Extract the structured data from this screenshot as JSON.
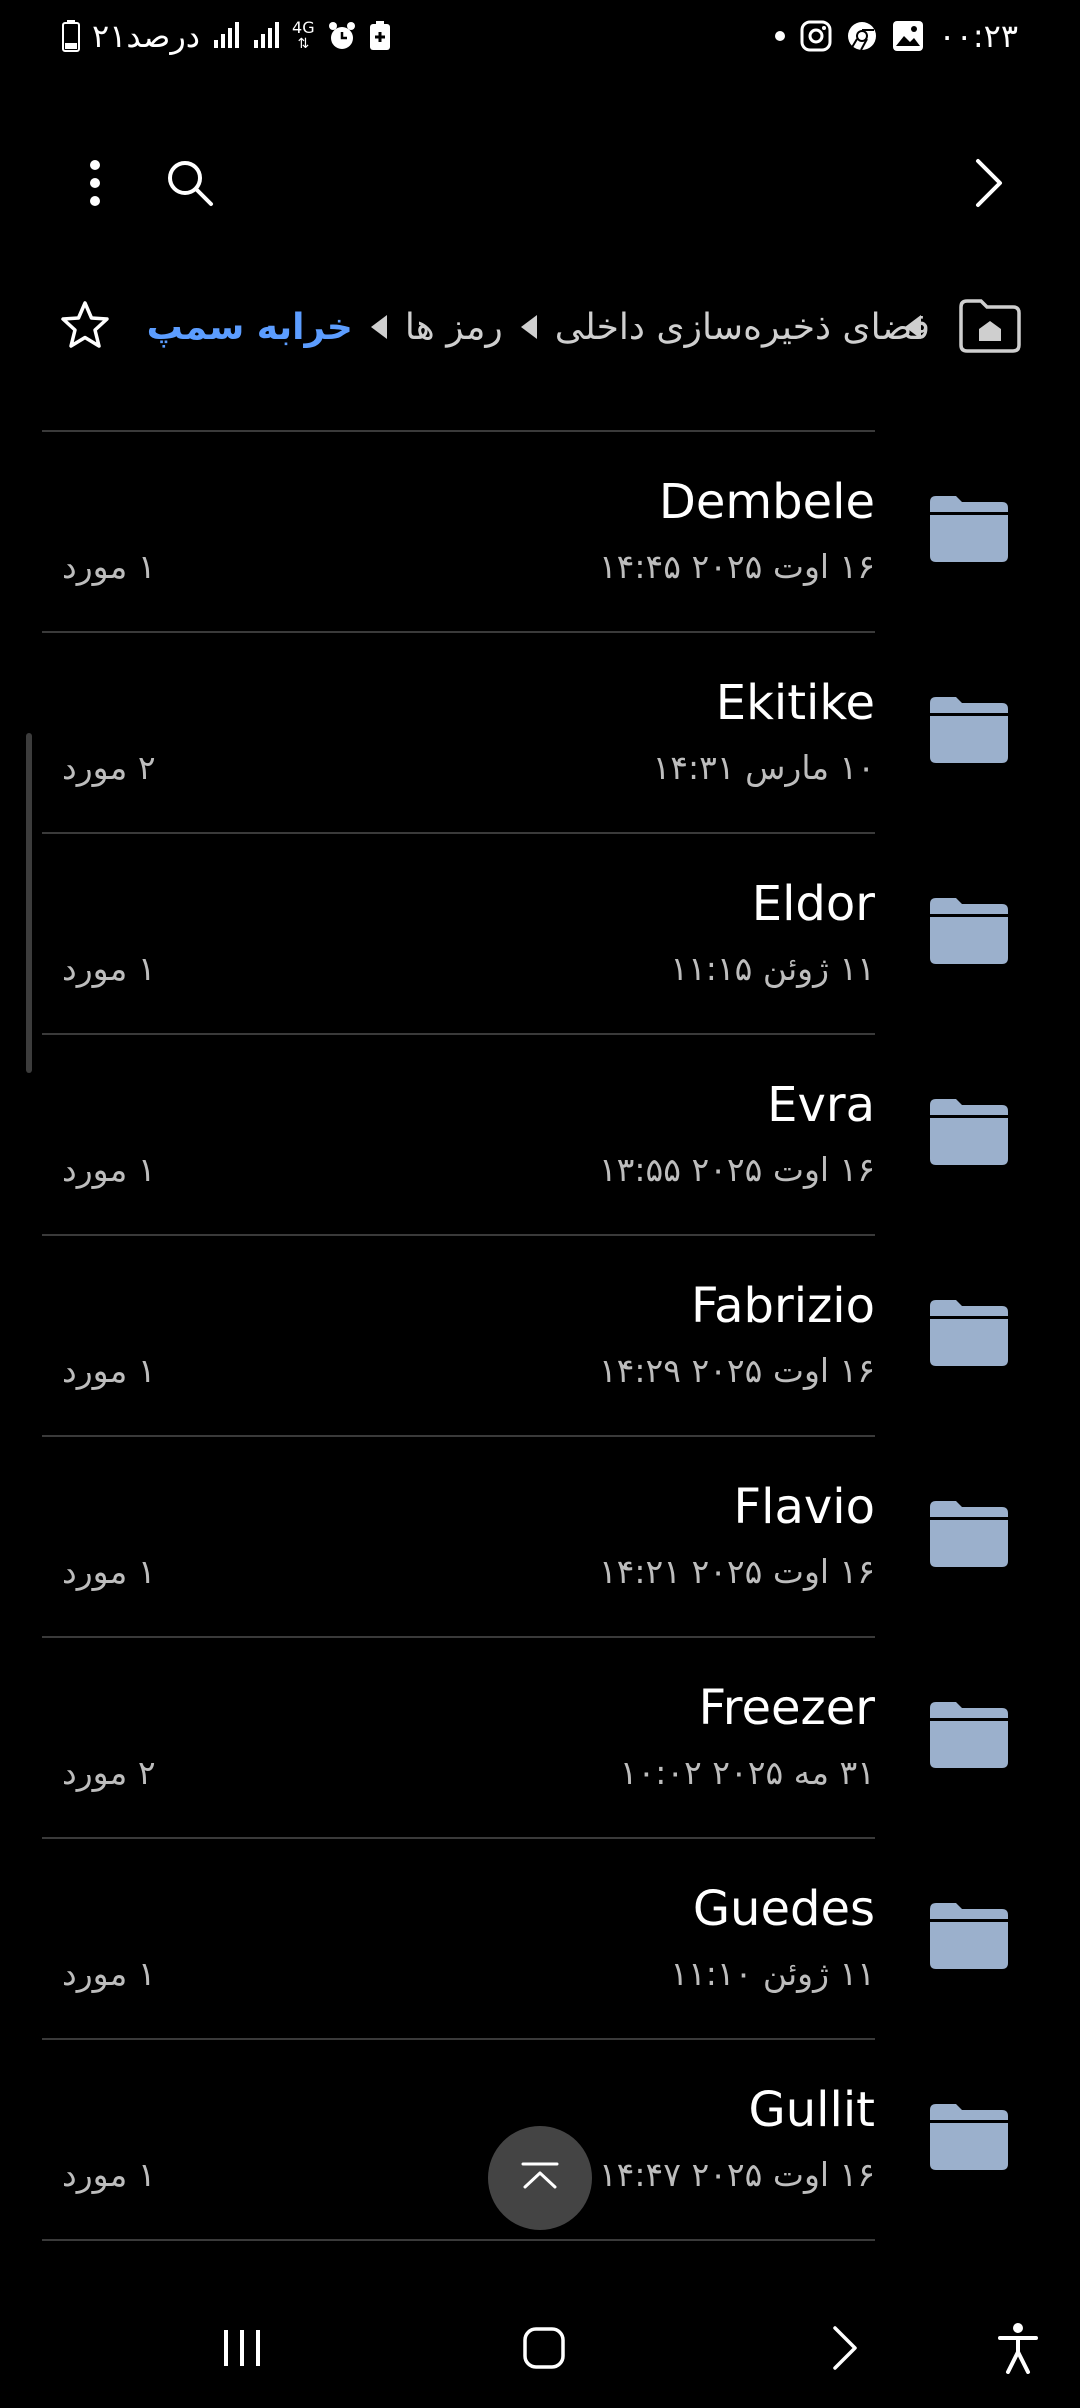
{
  "status_bar": {
    "time": "۰۰:۲۳",
    "battery_text": "۲۱درصد",
    "network": "4G",
    "colors": {
      "text": "#ffffff"
    },
    "icons": [
      "gallery-icon",
      "chrome-icon",
      "instagram-icon",
      "dot-icon",
      "alarm-icon",
      "battery-saver-icon",
      "signal-icon",
      "battery-icon"
    ]
  },
  "top_bar": {
    "icons": [
      "more-options-icon",
      "search-icon",
      "forward-arrow-icon"
    ]
  },
  "breadcrumb": {
    "items": [
      "فضای ذخیره‌سازی داخلی",
      "رمز ها"
    ],
    "current": "خرابه سمپ",
    "colors": {
      "current": "#5c9dff",
      "item": "#cfcfcf"
    }
  },
  "files": [
    {
      "name": "Dembele",
      "date": "۱۶ اوت ۲۰۲۵ ۱۴:۴۵",
      "count": "۱ مورد"
    },
    {
      "name": "Ekitike",
      "date": "۱۰ مارس ۱۴:۳۱",
      "count": "۲ مورد"
    },
    {
      "name": "Eldor",
      "date": "۱۱ ژوئن ۱۱:۱۵",
      "count": "۱ مورد"
    },
    {
      "name": "Evra",
      "date": "۱۶ اوت ۲۰۲۵ ۱۳:۵۵",
      "count": "۱ مورد"
    },
    {
      "name": "Fabrizio",
      "date": "۱۶ اوت ۲۰۲۵ ۱۴:۲۹",
      "count": "۱ مورد"
    },
    {
      "name": "Flavio",
      "date": "۱۶ اوت ۲۰۲۵ ۱۴:۲۱",
      "count": "۱ مورد"
    },
    {
      "name": "Freezer",
      "date": "۳۱ مه ۲۰۲۵ ۱۰:۰۲",
      "count": "۲ مورد"
    },
    {
      "name": "Guedes",
      "date": "۱۱ ژوئن ۱۱:۱۰",
      "count": "۱ مورد"
    },
    {
      "name": "Gullit",
      "date": "۱۶ اوت ۲۰۲۵ ۱۴:۴۷",
      "count": "۱ مورد"
    }
  ],
  "colors": {
    "background": "#000000",
    "folder": "#9bb0cc",
    "divider": "#3a3a3a",
    "secondary_text": "#bdbdbd"
  },
  "nav_bar": {
    "icons": [
      "recents-icon",
      "home-icon",
      "back-icon",
      "accessibility-icon"
    ]
  }
}
